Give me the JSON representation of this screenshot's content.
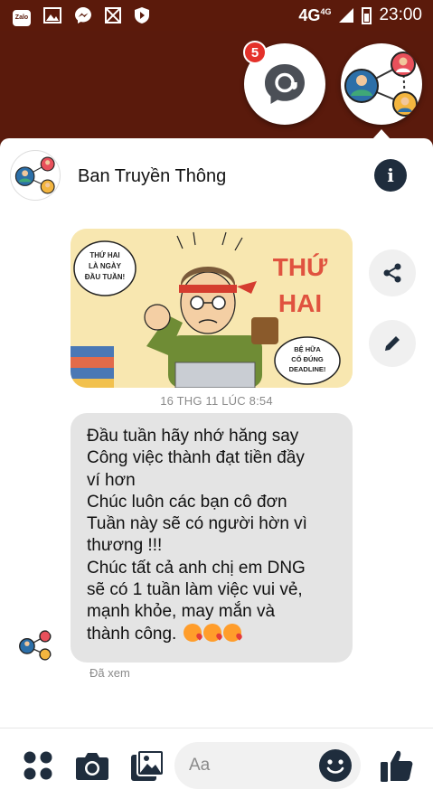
{
  "status_bar": {
    "network": "4G",
    "network_sup": "4G",
    "time": "23:00",
    "app_icons": [
      "zalo-icon",
      "gallery-icon",
      "messenger-icon",
      "mute-icon",
      "shield-icon"
    ],
    "zalo_label": "Zalo"
  },
  "chat_heads": {
    "badge_count": "5"
  },
  "header": {
    "title": "Ban Truyền Thông",
    "info_icon": "i"
  },
  "image_message": {
    "bubble_left": "THỨ HAI LÀ NGÀY ĐẦU TUẦN!",
    "big_text_1": "THỨ",
    "big_text_2": "HAI",
    "bubble_right": "BỆ HỮA CỐ ĐÚNG DEADLINE!"
  },
  "timestamp": "16 THG 11 LÚC 8:54",
  "text_message": {
    "lines": [
      "Đầu tuần hãy nhớ hăng say",
      "Công việc thành đạt tiền đầy",
      "ví hơn",
      "Chúc luôn các bạn cô đơn",
      "Tuần này sẽ có người hờn vì",
      "thương !!!",
      "Chúc tất cả anh chị em DNG",
      "sẽ có 1 tuần làm việc vui vẻ,",
      "mạnh khỏe, may mắn và",
      "thành công."
    ]
  },
  "seen_label": "Đã xem",
  "composer": {
    "placeholder": "Aa"
  },
  "colors": {
    "statusbar_bg": "#5b1a0b",
    "bubble_bg": "#e4e4e4",
    "icon_dark": "#1f2d3d",
    "badge_red": "#e4312a"
  }
}
